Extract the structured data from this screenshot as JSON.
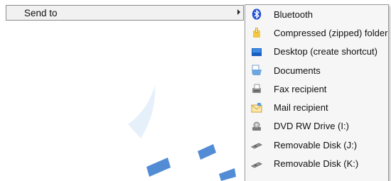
{
  "context_menu": {
    "send_to_label": "Send to"
  },
  "send_to_submenu": {
    "items": [
      {
        "label": "Bluetooth",
        "icon": "bluetooth-icon"
      },
      {
        "label": "Compressed (zipped) folder",
        "icon": "zip-folder-icon"
      },
      {
        "label": "Desktop (create shortcut)",
        "icon": "desktop-icon"
      },
      {
        "label": "Documents",
        "icon": "documents-icon"
      },
      {
        "label": "Fax recipient",
        "icon": "fax-icon"
      },
      {
        "label": "Mail recipient",
        "icon": "mail-icon"
      },
      {
        "label": "DVD RW Drive (I:)",
        "icon": "dvd-drive-icon"
      },
      {
        "label": "Removable Disk (J:)",
        "icon": "removable-disk-icon"
      },
      {
        "label": "Removable Disk (K:)",
        "icon": "removable-disk-icon"
      }
    ]
  },
  "colors": {
    "highlight_border": "#8a8a8a",
    "submenu_background": "#f6f6f6",
    "bluetooth_blue": "#1d4fd8"
  }
}
